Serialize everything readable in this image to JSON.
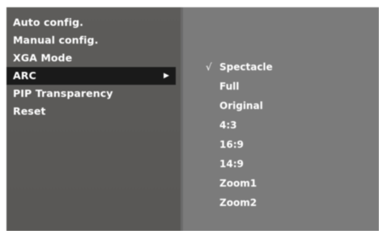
{
  "main_menu": {
    "items": [
      {
        "label": "Auto config."
      },
      {
        "label": "Manual config."
      },
      {
        "label": "XGA Mode"
      },
      {
        "label": "ARC",
        "arrow": "▶"
      },
      {
        "label": "PIP Transparency"
      },
      {
        "label": "Reset"
      }
    ]
  },
  "sub_menu": {
    "check_mark": "√",
    "items": [
      {
        "label": "Spectacle"
      },
      {
        "label": "Full"
      },
      {
        "label": "Original"
      },
      {
        "label": "4:3"
      },
      {
        "label": "16:9"
      },
      {
        "label": "14:9"
      },
      {
        "label": "Zoom1"
      },
      {
        "label": "Zoom2"
      }
    ]
  }
}
